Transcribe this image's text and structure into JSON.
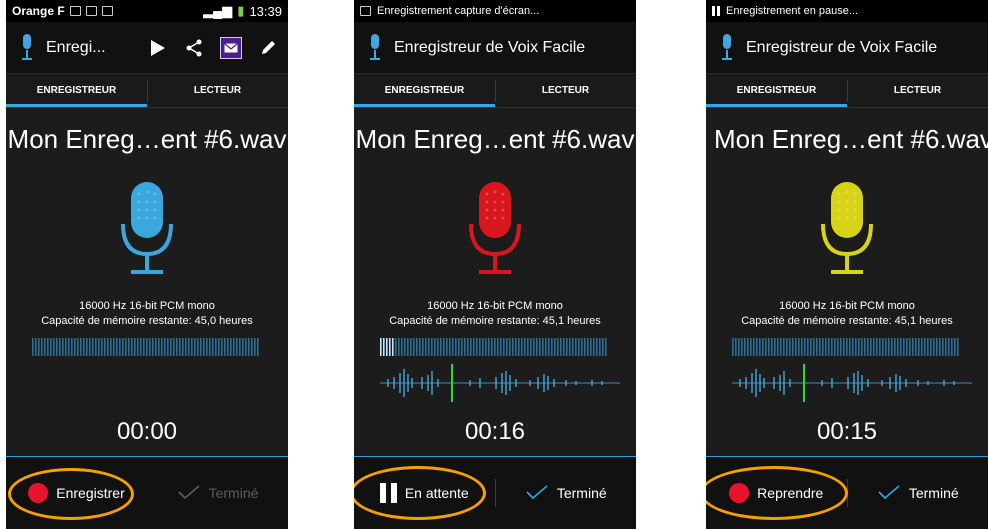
{
  "screens": [
    {
      "status": {
        "carrier": "Orange F",
        "time": "13:39",
        "notification": ""
      },
      "app_title": "Enregi...",
      "tabs": {
        "recorder": "ENREGISTREUR",
        "player": "LECTEUR"
      },
      "filename": "Mon Enreg…ent #6.wav",
      "mic_color": "#3aa7de",
      "info_format": "16000 Hz 16-bit PCM mono",
      "info_memory": "Capacité de mémoire restante: 45,0 heures",
      "level": 0,
      "timer": "00:00",
      "primary_label": "Enregistrer",
      "primary_icon": "record-dot-icon",
      "done_label": "Terminé",
      "done_enabled": false
    },
    {
      "status": {
        "carrier": "",
        "time": "",
        "notification": "Enregistrement capture d'écran..."
      },
      "app_title": "Enregistreur de Voix Facile",
      "tabs": {
        "recorder": "ENREGISTREUR",
        "player": "LECTEUR"
      },
      "filename": "Mon Enreg…ent #6.wav",
      "mic_color": "#d9161d",
      "info_format": "16000 Hz 16-bit PCM mono",
      "info_memory": "Capacité de mémoire restante: 45,1 heures",
      "level": 0.06,
      "timer": "00:16",
      "primary_label": "En attente",
      "primary_icon": "pause-icon",
      "done_label": "Terminé",
      "done_enabled": true
    },
    {
      "status": {
        "carrier": "",
        "time": "",
        "notification": "Enregistrement en pause..."
      },
      "app_title": "Enregistreur de Voix Facile",
      "tabs": {
        "recorder": "ENREGISTREUR",
        "player": "LECTEUR"
      },
      "filename": "Mon Enreg…ent #6.wav",
      "mic_color": "#d6d414",
      "info_format": "16000 Hz 16-bit PCM mono",
      "info_memory": "Capacité de mémoire restante: 45,1 heures",
      "level": 0,
      "timer": "00:15",
      "primary_label": "Reprendre",
      "primary_icon": "record-dot-icon",
      "done_label": "Terminé",
      "done_enabled": true
    }
  ],
  "highlight_color": "#f5a000",
  "accent_color": "#34a6e0"
}
